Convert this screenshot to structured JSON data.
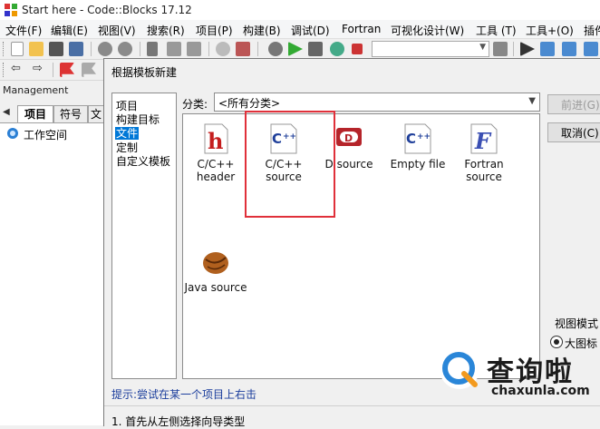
{
  "window": {
    "title": "Start here - Code::Blocks 17.12"
  },
  "menu": [
    "文件(F)",
    "编辑(E)",
    "视图(V)",
    "搜索(R)",
    "项目(P)",
    "构建(B)",
    "调试(D)",
    "Fortran",
    "可视化设计(W)",
    "工具 (T)",
    "工具+(O)",
    "插件"
  ],
  "management": {
    "header": "Management",
    "tabs": [
      "项目",
      "符号",
      "文"
    ],
    "workspace": "工作空间"
  },
  "dialog": {
    "title": "根据模板新建",
    "categories": [
      "项目",
      "构建目标",
      "文件",
      "定制",
      "自定义模板"
    ],
    "selected_category": "文件",
    "filter_label": "分类:",
    "filter_value": "<所有分类>",
    "templates": [
      {
        "label": "C/C++ header",
        "icon": "cpp-header-icon"
      },
      {
        "label": "C/C++ source",
        "icon": "cpp-source-icon"
      },
      {
        "label": "D source",
        "icon": "d-source-icon"
      },
      {
        "label": "Empty file",
        "icon": "empty-file-icon"
      },
      {
        "label": "Fortran source",
        "icon": "fortran-source-icon"
      },
      {
        "label": "Java source",
        "icon": "java-source-icon"
      }
    ],
    "next_button": "前进(G)",
    "cancel_button": "取消(C)",
    "view_mode_label": "视图模式",
    "view_large_icons": "大图标",
    "tip": "提示:尝试在某一个项目上右击",
    "step": "1. 首先从左侧选择向导类型"
  },
  "watermark": {
    "brand": "查询啦",
    "url": "chaxunla.com"
  },
  "colors": {
    "selection": "#0078d7",
    "highlight_box": "#e0303a",
    "tip_text": "#1a3d9c"
  }
}
